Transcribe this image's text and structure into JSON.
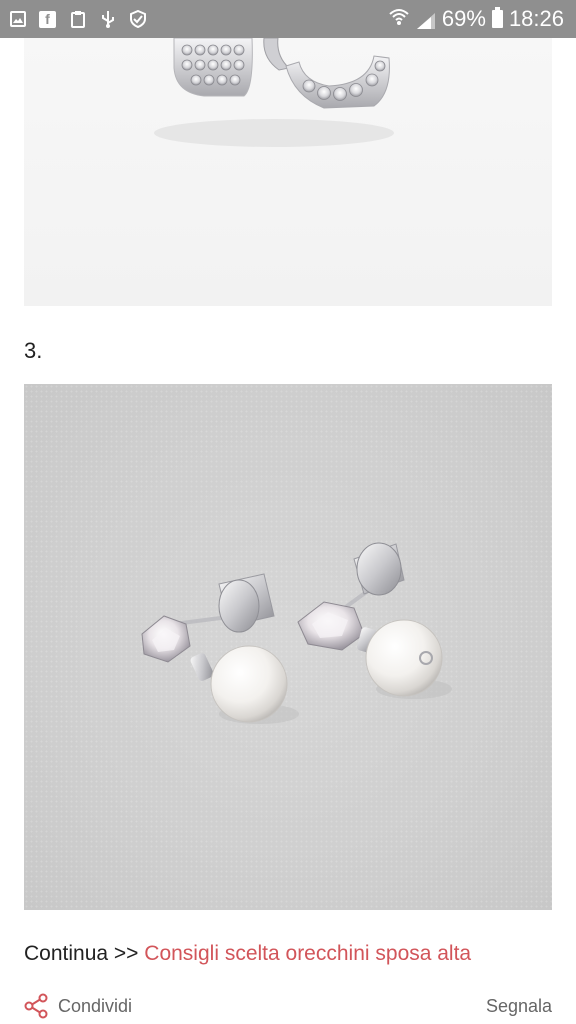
{
  "status_bar": {
    "battery": "69%",
    "time": "18:26"
  },
  "article": {
    "item_number": "3.",
    "continue_prefix": "Continua >>",
    "continue_link": "Consigli scelta orecchini sposa alta"
  },
  "footer": {
    "share_label": "Condividi",
    "report_label": "Segnala"
  },
  "colors": {
    "link": "#d2555a",
    "status_bar": "#8f8f8f"
  },
  "icons": [
    "image-icon",
    "facebook-icon",
    "clipboard-icon",
    "usb-icon",
    "shield-icon",
    "wifi-icon",
    "signal-icon",
    "battery-icon",
    "share-icon"
  ]
}
